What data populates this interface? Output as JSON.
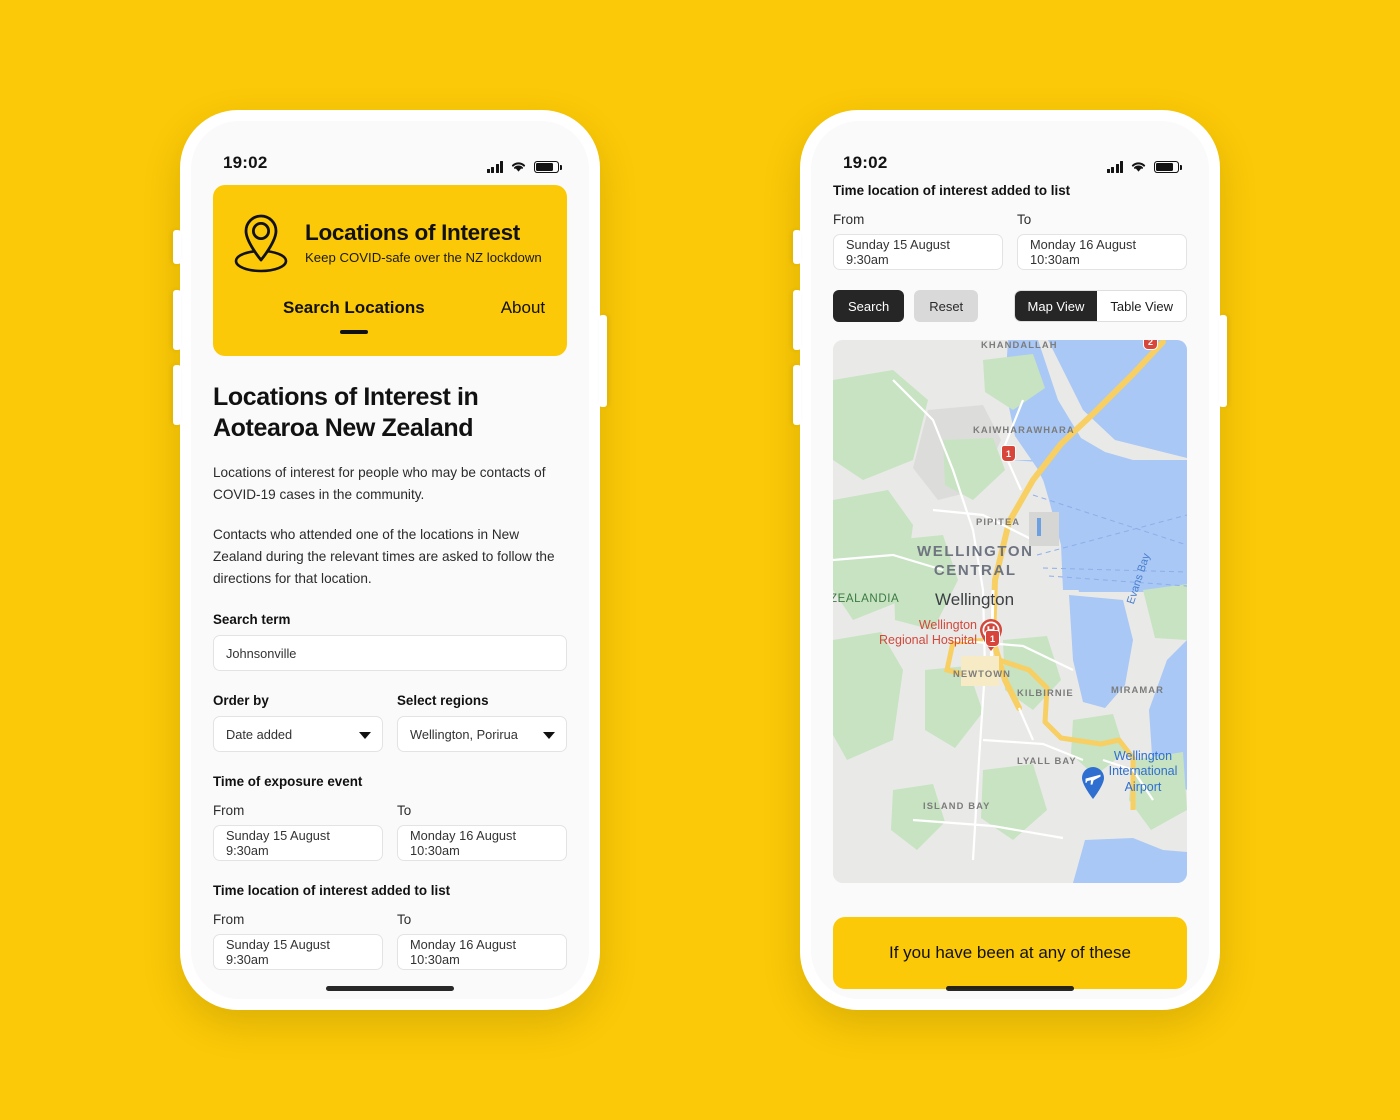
{
  "background_color": "#FBC907",
  "brand": {
    "yellow": "#FBC907",
    "dark": "#262626",
    "grey_button": "#D9D9D9"
  },
  "status_bar": {
    "time": "19:02",
    "signal_icon": "signal-bars-icon",
    "wifi_icon": "wifi-icon",
    "battery_icon": "battery-icon"
  },
  "left_phone": {
    "hero": {
      "logo_icon": "location-pin-icon",
      "title": "Locations of Interest",
      "subtitle": "Keep COVID-safe over the NZ lockdown",
      "nav": [
        {
          "label": "Search Locations",
          "active": true
        },
        {
          "label": "About",
          "active": false
        }
      ]
    },
    "page_title": "Locations of Interest in Aotearoa New Zealand",
    "paragraphs": [
      "Locations of interest for people who may be contacts of COVID-19 cases in the community.",
      "Contacts who attended one of the locations in New Zealand during the relevant times are asked to follow the directions for that location."
    ],
    "search_term": {
      "label": "Search term",
      "value": "Johnsonville",
      "placeholder": "Search term"
    },
    "order_by": {
      "label": "Order by",
      "value": "Date added",
      "caret_icon": "chevron-down-icon"
    },
    "select_regions": {
      "label": "Select regions",
      "value": "Wellington, Porirua",
      "caret_icon": "chevron-down-icon"
    },
    "exposure_event": {
      "label": "Time of exposure event",
      "from_label": "From",
      "from_value": "Sunday 15 August 9:30am",
      "to_label": "To",
      "to_value": "Monday 16 August 10:30am"
    },
    "added_to_list": {
      "label": "Time location of interest added to list",
      "from_label": "From",
      "from_value": "Sunday 15 August 9:30am",
      "to_label": "To",
      "to_value": "Monday 16 August 10:30am"
    }
  },
  "right_phone": {
    "added_to_list": {
      "label": "Time location of interest added to list",
      "from_label": "From",
      "from_value": "Sunday 15 August 9:30am",
      "to_label": "To",
      "to_value": "Monday 16 August 10:30am"
    },
    "actions": {
      "search_label": "Search",
      "reset_label": "Reset"
    },
    "view_toggle": {
      "map_label": "Map View",
      "table_label": "Table View",
      "selected": "Map View"
    },
    "map": {
      "city_label": "Wellington",
      "district_line1": "WELLINGTON",
      "district_line2": "CENTRAL",
      "suburbs": [
        "KHANDALLAH",
        "KAIWHARAWHARA",
        "PIPITEA",
        "NEWTOWN",
        "KILBIRNIE",
        "MIRAMAR",
        "LYALL BAY",
        "ISLAND BAY"
      ],
      "park_label": "ZEALANDIA",
      "bay_label": "Evans Bay",
      "hospital_line1": "Wellington",
      "hospital_line2": "Regional Hospital",
      "hospital_icon": "hospital-marker-icon",
      "airport_line1": "Wellington",
      "airport_line2": "International",
      "airport_line3": "Airport",
      "airport_icon": "airport-marker-icon",
      "highway_shields": [
        "1",
        "1",
        "2"
      ]
    },
    "banner_text": "If you have been at any of these"
  }
}
